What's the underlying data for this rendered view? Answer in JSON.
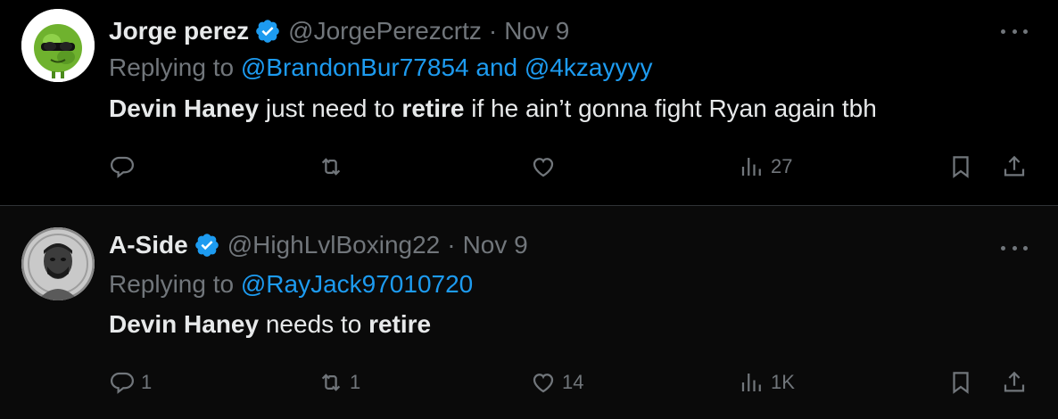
{
  "tweets": [
    {
      "name": "Jorge perez",
      "handle": "@JorgePerezcrtz",
      "separator": "·",
      "date": "Nov 9",
      "replying_prefix": "Replying to",
      "replying_to": "@BrandonBur77854 and @4kzayyyy",
      "body": {
        "part1": "Devin Haney",
        "part2": " just need to ",
        "part3": "retire",
        "part4": " if he ain’t gonna fight Ryan again tbh"
      },
      "replies": "",
      "retweets": "",
      "likes": "",
      "views": "27"
    },
    {
      "name": "A-Side",
      "handle": "@HighLvlBoxing22",
      "separator": "·",
      "date": "Nov 9",
      "replying_prefix": "Replying to",
      "replying_to": "@RayJack97010720",
      "body": {
        "part1": "Devin Haney",
        "part2": " needs to ",
        "part3": "retire",
        "part4": ""
      },
      "replies": "1",
      "retweets": "1",
      "likes": "14",
      "views": "1K"
    }
  ],
  "colors": {
    "background": "#000000",
    "text": "#e7e9ea",
    "muted": "#71767b",
    "link": "#1d9bf0",
    "verified": "#1d9bf0",
    "divider": "#2f3336"
  },
  "icons": [
    "verified-badge-icon",
    "more-icon",
    "reply-icon",
    "retweet-icon",
    "like-icon",
    "views-icon",
    "bookmark-icon",
    "share-icon"
  ]
}
